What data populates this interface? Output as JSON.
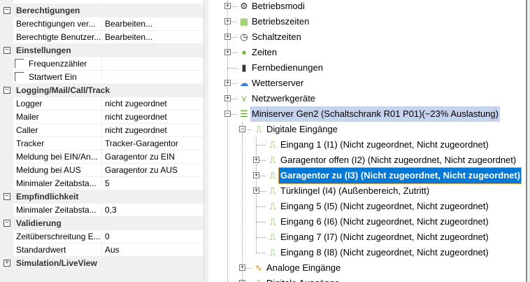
{
  "properties": {
    "categories": [
      {
        "label": "Berechtigungen",
        "expanded": true,
        "items": [
          {
            "key": "Berechtigungen ver...",
            "value": "Bearbeiten..."
          },
          {
            "key": "Berechtigte Benutzer...",
            "value": "Bearbeiten..."
          }
        ]
      },
      {
        "label": "Einstellungen",
        "expanded": true,
        "items": [
          {
            "key": "Frequenzzähler",
            "checkbox": true,
            "checked": false
          },
          {
            "key": "Startwert Ein",
            "checkbox": true,
            "checked": false
          }
        ]
      },
      {
        "label": "Logging/Mail/Call/Track",
        "expanded": true,
        "items": [
          {
            "key": "Logger",
            "value": "nicht zugeordnet"
          },
          {
            "key": "Mailer",
            "value": "nicht zugeordnet"
          },
          {
            "key": "Caller",
            "value": "nicht zugeordnet"
          },
          {
            "key": "Tracker",
            "value": "Tracker-Garagentor"
          },
          {
            "key": "Meldung bei EIN/An...",
            "value": "Garagentor zu EIN"
          },
          {
            "key": "Meldung bei AUS",
            "value": "Garagentor zu AUS"
          },
          {
            "key": "Minimaler Zeitabsta...",
            "value": "5"
          }
        ]
      },
      {
        "label": "Empfindlichkeit",
        "expanded": true,
        "items": [
          {
            "key": "Minimaler Zeitabsta...",
            "value": "0,3"
          }
        ]
      },
      {
        "label": "Validierung",
        "expanded": true,
        "items": [
          {
            "key": "Zeitüberschreitung E...",
            "value": "0"
          },
          {
            "key": "Standardwert",
            "value": "Aus"
          }
        ]
      },
      {
        "label": "Simulation/LiveView",
        "expanded": false,
        "items": []
      }
    ]
  },
  "tree": [
    {
      "label": "Betriebsmodi",
      "level": 0,
      "expander": "+",
      "icon": "gear-icon",
      "glyph": "⚙",
      "color": "#333"
    },
    {
      "label": "Betriebszeiten",
      "level": 0,
      "expander": "+",
      "icon": "calendar-icon",
      "glyph": "▦",
      "color": "#7ab648"
    },
    {
      "label": "Schaltzeiten",
      "level": 0,
      "expander": "+",
      "icon": "clock-icon",
      "glyph": "◷",
      "color": "#333"
    },
    {
      "label": "Zeiten",
      "level": 0,
      "expander": "+",
      "icon": "timer-icon",
      "glyph": "●",
      "color": "#7ab648"
    },
    {
      "label": "Fernbedienungen",
      "level": 0,
      "expander": "",
      "icon": "remote-icon",
      "glyph": "▮",
      "color": "#333"
    },
    {
      "label": "Wetterserver",
      "level": 0,
      "expander": "+",
      "icon": "weather-icon",
      "glyph": "☁",
      "color": "#3a7bd5"
    },
    {
      "label": "Netzwerkgeräte",
      "level": 0,
      "expander": "+",
      "icon": "network-icon",
      "glyph": "⋎",
      "color": "#7ab648"
    },
    {
      "label": "Miniserver Gen2 (Schaltschrank R01 P01)(~23% Auslastung)",
      "level": 0,
      "expander": "−",
      "icon": "miniserver-icon",
      "glyph": "☰",
      "color": "#5a9a2a",
      "state": "highlighted"
    },
    {
      "label": "Digitale Eingänge",
      "level": 1,
      "expander": "−",
      "icon": "digital-input-icon",
      "glyph": "⎍",
      "color": "#5a9a2a"
    },
    {
      "label": "Eingang 1 (I1) (Nicht zugeordnet, Nicht zugeordnet)",
      "level": 2,
      "expander": "",
      "icon": "digital-input-icon",
      "glyph": "⎍",
      "color": "#5a9a2a"
    },
    {
      "label": "Garagentor offen (I2) (Nicht zugeordnet, Nicht zugeordnet)",
      "level": 2,
      "expander": "+",
      "icon": "digital-input-icon",
      "glyph": "⎍",
      "color": "#5a9a2a"
    },
    {
      "label": "Garagentor zu (I3) (Nicht zugeordnet, Nicht zugeordnet)",
      "level": 2,
      "expander": "+",
      "icon": "digital-input-icon",
      "glyph": "⎍",
      "color": "#5a9a2a",
      "state": "selected"
    },
    {
      "label": "Türklingel (I4) (Außenbereich, Zutritt)",
      "level": 2,
      "expander": "+",
      "icon": "digital-input-icon",
      "glyph": "⎍",
      "color": "#5a9a2a"
    },
    {
      "label": "Eingang 5 (I5) (Nicht zugeordnet, Nicht zugeordnet)",
      "level": 2,
      "expander": "",
      "icon": "digital-input-icon",
      "glyph": "⎍",
      "color": "#5a9a2a"
    },
    {
      "label": "Eingang 6 (I6) (Nicht zugeordnet, Nicht zugeordnet)",
      "level": 2,
      "expander": "",
      "icon": "digital-input-icon",
      "glyph": "⎍",
      "color": "#5a9a2a"
    },
    {
      "label": "Eingang 7 (I7) (Nicht zugeordnet, Nicht zugeordnet)",
      "level": 2,
      "expander": "",
      "icon": "digital-input-icon",
      "glyph": "⎍",
      "color": "#5a9a2a"
    },
    {
      "label": "Eingang 8 (I8) (Nicht zugeordnet, Nicht zugeordnet)",
      "level": 2,
      "expander": "",
      "icon": "digital-input-icon",
      "glyph": "⎍",
      "color": "#5a9a2a"
    },
    {
      "label": "Analoge Eingänge",
      "level": 1,
      "expander": "+",
      "icon": "analog-input-icon",
      "glyph": "∿",
      "color": "#e08a1e"
    },
    {
      "label": "Digitale Ausgänge",
      "level": 1,
      "expander": "+",
      "icon": "digital-output-icon",
      "glyph": "⎍",
      "color": "#5a9a2a"
    }
  ]
}
